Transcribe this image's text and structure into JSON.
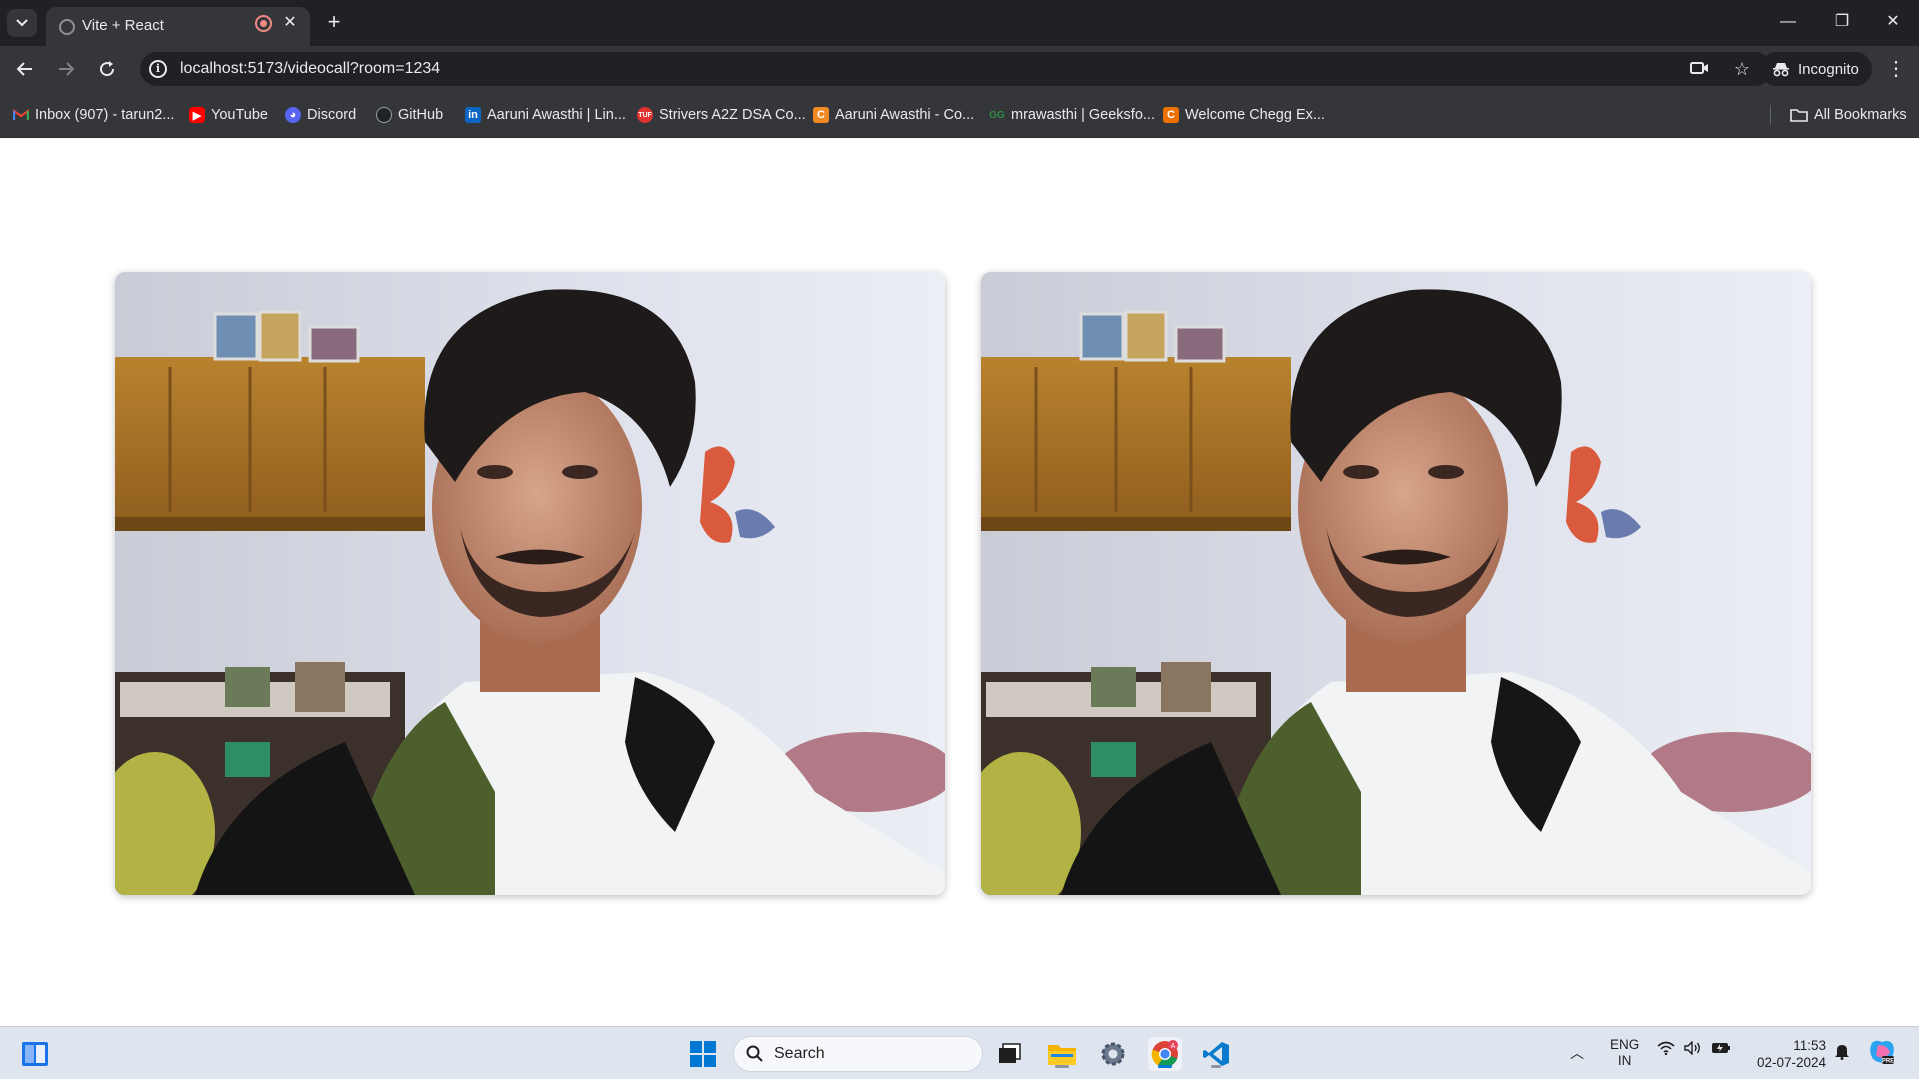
{
  "browser": {
    "tab": {
      "title": "Vite + React",
      "favicon": "globe-icon",
      "recording": true
    },
    "address": {
      "url": "localhost:5173/videocall?room=1234"
    },
    "profile": {
      "label": "Incognito"
    },
    "bookmarks": [
      {
        "label": "Inbox (907) - tarun2...",
        "icon": "gmail-icon",
        "color": "#ea4335"
      },
      {
        "label": "YouTube",
        "icon": "youtube-icon",
        "color": "#ff0000"
      },
      {
        "label": "Discord",
        "icon": "discord-icon",
        "color": "#5865f2"
      },
      {
        "label": "GitHub",
        "icon": "github-icon",
        "color": "#e8eaed"
      },
      {
        "label": "Aaruni Awasthi | Lin...",
        "icon": "linkedin-icon",
        "color": "#0a66c2"
      },
      {
        "label": "Strivers A2Z DSA Co...",
        "icon": "tuf-icon",
        "color": "#e0322f"
      },
      {
        "label": "Aaruni Awasthi - Co...",
        "icon": "codechef-icon",
        "color": "#f08a24"
      },
      {
        "label": "mrawasthi | Geeksfo...",
        "icon": "gfg-icon",
        "color": "#2f8d46"
      },
      {
        "label": "Welcome Chegg Ex...",
        "icon": "chegg-icon",
        "color": "#eb7100"
      }
    ],
    "all_bookmarks": "All Bookmarks"
  },
  "page": {
    "videos": [
      {
        "role": "local-video",
        "alt": ""
      },
      {
        "role": "remote-video",
        "alt": ""
      }
    ]
  },
  "taskbar": {
    "search_placeholder": "Search",
    "language": "ENG",
    "region": "IN",
    "time": "11:53",
    "date": "02-07-2024"
  },
  "colors": {
    "chrome_dark": "#202124",
    "chrome_toolbar": "#35363a",
    "taskbar": "#dfe5ef",
    "accent_blue": "#0078d4"
  }
}
